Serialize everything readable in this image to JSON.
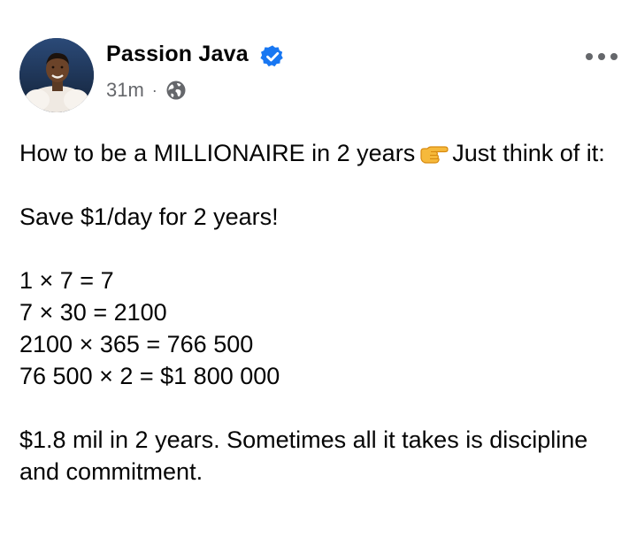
{
  "post": {
    "author": {
      "name": "Passion Java",
      "verified": true,
      "verified_color": "#1877f2"
    },
    "meta": {
      "time": "31m",
      "separator": "·",
      "audience_icon": "globe-icon"
    },
    "more_icon": "more-horizontal-icon",
    "content": {
      "line1_part1": "How to be a MILLIONAIRE in 2 years",
      "line1_emoji": "backhand-index-pointing-right",
      "line1_part2": "Just think of it:",
      "line2": "Save $1/day for 2 years!",
      "calc": [
        "1 × 7 = 7",
        "7 × 30 = 2100",
        "2100 × 365 = 766 500",
        "76 500 × 2 = $1 800 000"
      ],
      "closing": "$1.8 mil in 2 years. Sometimes all it takes is discipline and commitment."
    }
  }
}
